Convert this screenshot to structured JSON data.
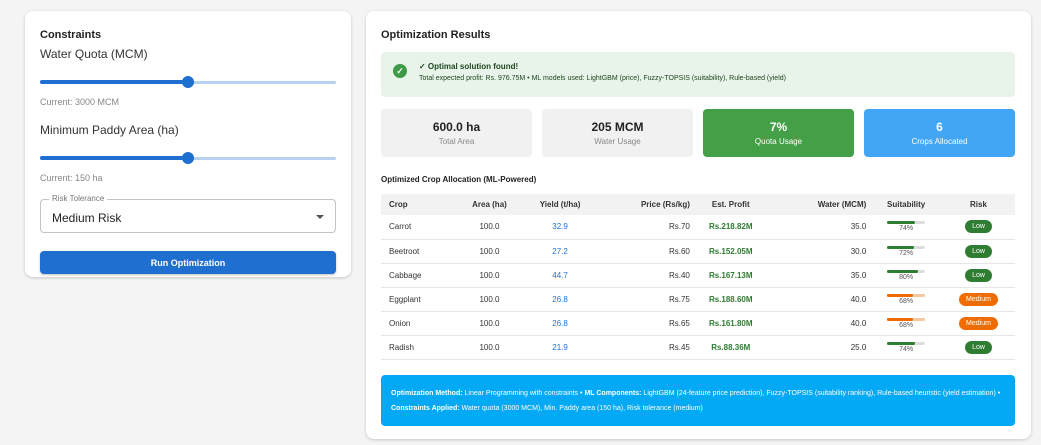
{
  "constraints": {
    "title": "Constraints",
    "water_label": "Water Quota (MCM)",
    "water_level": 0.5,
    "water_current": "Current: 3000 MCM",
    "paddy_label": "Minimum Paddy Area (ha)",
    "paddy_level": 0.5,
    "paddy_current": "Current: 150 ha",
    "risk_legend": "Risk Tolerance",
    "risk_value": "Medium Risk",
    "run_label": "Run Optimization"
  },
  "results": {
    "title": "Optimization Results",
    "alert_title": "✓ Optimal solution found!",
    "alert_desc": "Total expected profit: Rs. 976.75M • ML models used: LightGBM (price), Fuzzy-TOPSIS (suitability), Rule-based (yield)",
    "stats": [
      {
        "value": "600.0 ha",
        "label": "Total Area"
      },
      {
        "value": "205 MCM",
        "label": "Water Usage"
      },
      {
        "value": "7%",
        "label": "Quota Usage"
      },
      {
        "value": "6",
        "label": "Crops Allocated"
      }
    ],
    "table_title": "Optimized Crop Allocation (ML-Powered)",
    "columns": [
      "Crop",
      "Area (ha)",
      "Yield (t/ha)",
      "Price (Rs/kg)",
      "Est. Profit",
      "Water (MCM)",
      "Suitability",
      "Risk"
    ],
    "rows": [
      {
        "crop": "Carrot",
        "area": "100.0",
        "yield": "32.9",
        "price": "Rs.70",
        "profit": "Rs.218.82M",
        "water": "35.0",
        "suit": "74%",
        "suit_level": 0.74,
        "risk": "Low"
      },
      {
        "crop": "Beetroot",
        "area": "100.0",
        "yield": "27.2",
        "price": "Rs.60",
        "profit": "Rs.152.05M",
        "water": "30.0",
        "suit": "72%",
        "suit_level": 0.72,
        "risk": "Low"
      },
      {
        "crop": "Cabbage",
        "area": "100.0",
        "yield": "44.7",
        "price": "Rs.40",
        "profit": "Rs.167.13M",
        "water": "35.0",
        "suit": "80%",
        "suit_level": 0.8,
        "risk": "Low"
      },
      {
        "crop": "Eggplant",
        "area": "100.0",
        "yield": "26.8",
        "price": "Rs.75",
        "profit": "Rs.188.60M",
        "water": "40.0",
        "suit": "68%",
        "suit_level": 0.68,
        "risk": "Medium"
      },
      {
        "crop": "Onion",
        "area": "100.0",
        "yield": "26.8",
        "price": "Rs.65",
        "profit": "Rs.161.80M",
        "water": "40.0",
        "suit": "68%",
        "suit_level": 0.68,
        "risk": "Medium"
      },
      {
        "crop": "Radish",
        "area": "100.0",
        "yield": "21.9",
        "price": "Rs.45",
        "profit": "Rs.88.36M",
        "water": "25.0",
        "suit": "74%",
        "suit_level": 0.74,
        "risk": "Low"
      }
    ],
    "footer": {
      "method_label": "Optimization Method:",
      "method_text": " Linear Programming with constraints • ",
      "ml_label": "ML Components:",
      "ml_text": " LightGBM (24-feature price prediction), Fuzzy-TOPSIS (suitability ranking), Rule-based heuristic (yield estimation) • ",
      "constraints_label": "Constraints Applied:",
      "constraints_text": " Water quota (3000 MCM), Min. Paddy area (150 ha), Risk tolerance (medium)"
    }
  },
  "colors": {
    "primary": "#1e6fd0",
    "success": "#43a047",
    "info": "#42a5f5",
    "low_risk": "#2e7d32",
    "medium_risk": "#ef6c00",
    "footer_bg": "#03a9f4"
  }
}
